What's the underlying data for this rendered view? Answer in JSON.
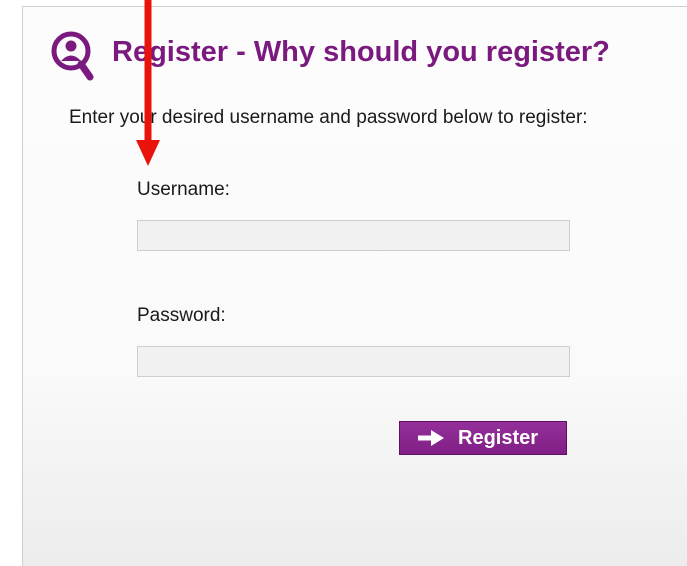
{
  "header": {
    "icon": "magnifier-person-icon",
    "title": "Register - Why should you register?"
  },
  "form": {
    "intro": "Enter your desired username and password below to register:",
    "username_label": "Username:",
    "username_value": "",
    "password_label": "Password:",
    "password_value": "",
    "register_button": "Register",
    "button_icon": "right-arrow-icon"
  },
  "annotation": {
    "icon": "red-arrow-down-icon"
  },
  "colors": {
    "brand": "#7b1a7e",
    "button": "#8a2490",
    "annotation": "#e8140c",
    "field_bg": "#f1f1f1"
  }
}
